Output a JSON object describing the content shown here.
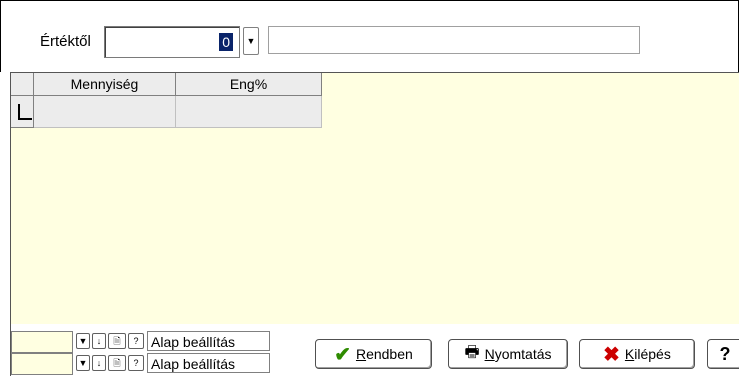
{
  "filter": {
    "label": "Értéktől",
    "value": "0",
    "dropdown_icon": "chevron-down-icon",
    "description": ""
  },
  "grid": {
    "columns": [
      "Mennyiség",
      "Eng%"
    ],
    "rows": [
      [
        "",
        ""
      ]
    ]
  },
  "bottom": {
    "rows": [
      {
        "input": "",
        "preset": "Alap beállítás"
      },
      {
        "input": "",
        "preset": "Alap beállítás"
      }
    ],
    "icons": [
      "chevron-down-icon",
      "arrow-down-icon",
      "document-icon",
      "help-icon"
    ]
  },
  "buttons": {
    "ok": "Rendben",
    "print": "Nyomtatás",
    "exit": "Kilépés",
    "help": "?"
  },
  "colors": {
    "panel_yellow": "#ffffe1",
    "selection": "#0a246a",
    "ok_check": "#2e8b00",
    "exit_x": "#cc0000"
  }
}
